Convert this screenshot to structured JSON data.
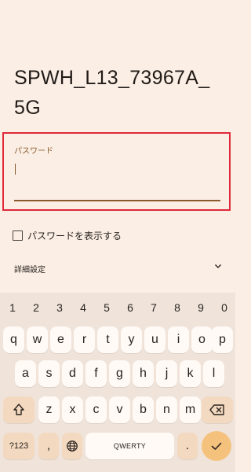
{
  "network": {
    "title": "SPWH_L13_73967A_5G"
  },
  "password": {
    "label": "パスワード",
    "value": ""
  },
  "show_password": {
    "label": "パスワードを表示する",
    "checked": false
  },
  "advanced": {
    "label": "詳細設定"
  },
  "keyboard": {
    "numbers": [
      "1",
      "2",
      "3",
      "4",
      "5",
      "6",
      "7",
      "8",
      "9",
      "0"
    ],
    "row1": [
      "q",
      "w",
      "e",
      "r",
      "t",
      "y",
      "u",
      "i",
      "o",
      "p"
    ],
    "row2": [
      "a",
      "s",
      "d",
      "f",
      "g",
      "h",
      "j",
      "k",
      "l"
    ],
    "row3": [
      "z",
      "x",
      "c",
      "v",
      "b",
      "n",
      "m"
    ],
    "symbols_key": "?123",
    "comma_key": ",",
    "space_key": "QWERTY",
    "period_key": "."
  },
  "colors": {
    "background": "#fbeee5",
    "highlight_border": "#e0283a",
    "accent": "#8a5a2c",
    "function_key": "#f3d9bf",
    "enter_key": "#f5c27e"
  }
}
